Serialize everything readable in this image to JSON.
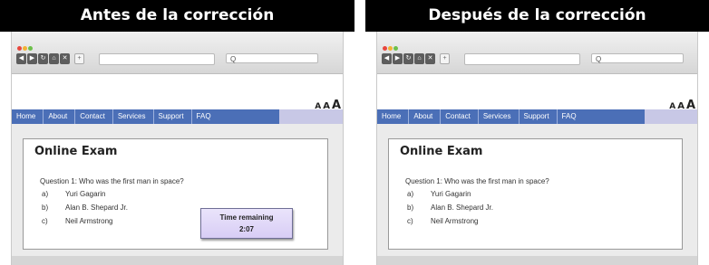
{
  "panels": {
    "before": {
      "banner": "Antes de la corrección",
      "search_icon": "Q",
      "aaa": [
        "A",
        "A",
        "A"
      ],
      "nav": [
        "Home",
        "About",
        "Contact",
        "Services",
        "Support",
        "FAQ"
      ],
      "exam": {
        "title": "Online Exam",
        "question": "Question 1: Who  was the first man in space?",
        "options": [
          {
            "letter": "a)",
            "text": "Yuri Gagarin"
          },
          {
            "letter": "b)",
            "text": "Alan B. Shepard Jr."
          },
          {
            "letter": "c)",
            "text": "Neil Armstrong"
          }
        ],
        "timer": {
          "label": "Time remaining",
          "value": "2:07"
        }
      }
    },
    "after": {
      "banner": "Después de la corrección",
      "search_icon": "Q",
      "aaa": [
        "A",
        "A",
        "A"
      ],
      "nav": [
        "Home",
        "About",
        "Contact",
        "Services",
        "Support",
        "FAQ"
      ],
      "exam": {
        "title": "Online Exam",
        "question": "Question 1: Who  was the first man in space?",
        "options": [
          {
            "letter": "a)",
            "text": "Yuri Gagarin"
          },
          {
            "letter": "b)",
            "text": "Alan B. Shepard Jr."
          },
          {
            "letter": "c)",
            "text": "Neil Armstrong"
          }
        ]
      }
    }
  },
  "icons": {
    "nav_buttons": [
      "back-icon",
      "forward-icon",
      "reload-icon",
      "home-icon",
      "close-icon",
      "new-tab-icon"
    ],
    "glyphs": [
      "◀",
      "▶",
      "↻",
      "⌂",
      "✕",
      "+"
    ]
  },
  "colors": {
    "navbar": "#4b6fb7",
    "traffic_lights": [
      "#e8463d",
      "#f2b233",
      "#6cc04a"
    ],
    "timer_bg": "#ddd3f7"
  }
}
